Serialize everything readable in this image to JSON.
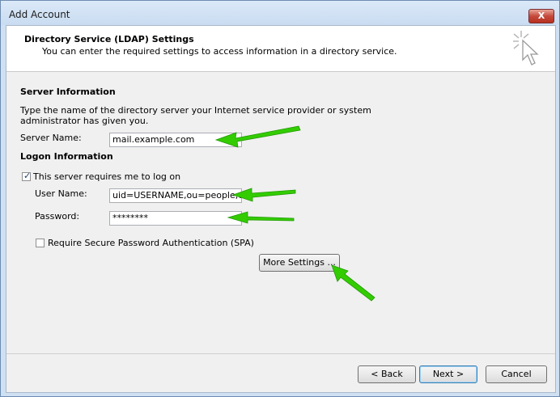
{
  "window": {
    "title": "Add Account",
    "close_label": "X"
  },
  "header": {
    "title": "Directory Service (LDAP) Settings",
    "subtitle": "You can enter the required settings to access information in a directory service."
  },
  "server_info": {
    "heading": "Server Information",
    "description_line1": "Type the name of the directory server your Internet service provider or system",
    "description_line2": "administrator has given you.",
    "server_name_label": "Server Name:",
    "server_name_value": "mail.example.com"
  },
  "logon_info": {
    "heading": "Logon Information",
    "requires_logon_label": "This server requires me to log on",
    "requires_logon_checked": true,
    "user_name_label": "User Name:",
    "user_name_value": "uid=USERNAME,ou=people,dc",
    "password_label": "Password:",
    "password_value": "********",
    "spa_label": "Require Secure Password Authentication (SPA)",
    "spa_checked": false
  },
  "buttons": {
    "more_settings": "More Settings ...",
    "back": "< Back",
    "next": "Next >",
    "cancel": "Cancel"
  },
  "colors": {
    "annotation_arrow": "#33cc00",
    "accent": "#3c7fb1"
  }
}
